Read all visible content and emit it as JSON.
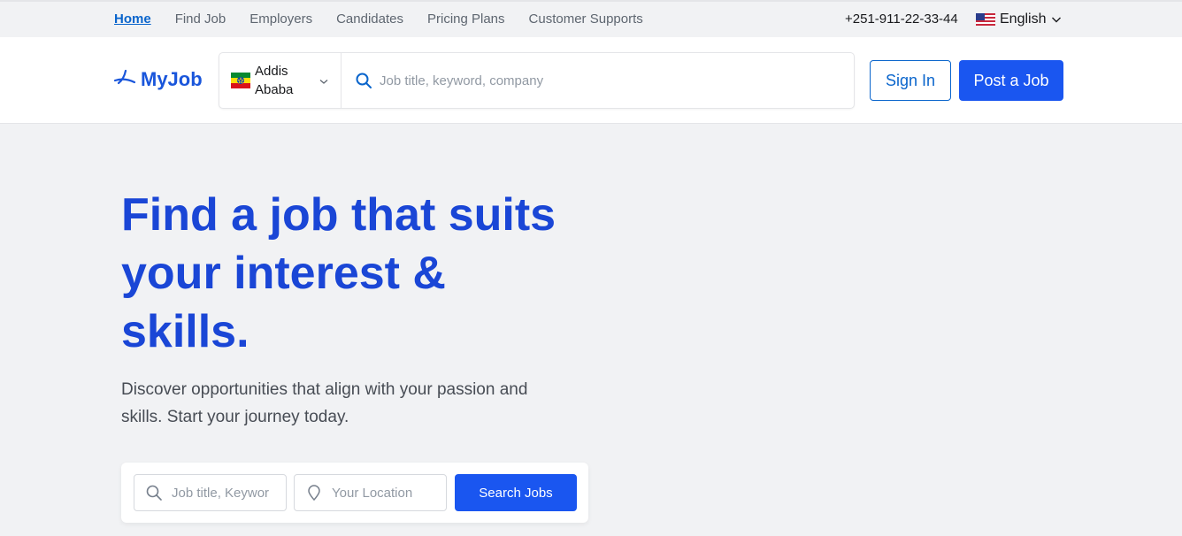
{
  "topnav": {
    "items": [
      {
        "label": "Home",
        "active": true
      },
      {
        "label": "Find Job"
      },
      {
        "label": "Employers"
      },
      {
        "label": "Candidates"
      },
      {
        "label": "Pricing Plans"
      },
      {
        "label": "Customer Supports"
      }
    ],
    "phone": "+251-911-22-33-44",
    "language": "English",
    "language_flag_icon": "us-flag-icon"
  },
  "header": {
    "logo_text": "MyJob",
    "logo_icon": "myjob-logo-icon",
    "location_select": {
      "line1": "Addis",
      "line2": "Ababa",
      "flag_icon": "ethiopia-flag-icon"
    },
    "search_placeholder": "Job title, keyword, company",
    "signin_label": "Sign In",
    "post_job_label": "Post a Job"
  },
  "hero": {
    "title_line1": "Find a job that suits",
    "title_line2": "your interest &",
    "title_line3": "skills.",
    "subtitle_line1": "Discover opportunities that align with your passion and",
    "subtitle_line2": "skills. Start your journey today.",
    "search": {
      "keyword_placeholder": "Job title, Keyword...",
      "location_placeholder": "Your Location",
      "button_label": "Search Jobs"
    }
  },
  "colors": {
    "primary": "#1a56f0",
    "link": "#0a65cc",
    "hero_title": "#1a46d6",
    "background": "#f1f2f4"
  }
}
